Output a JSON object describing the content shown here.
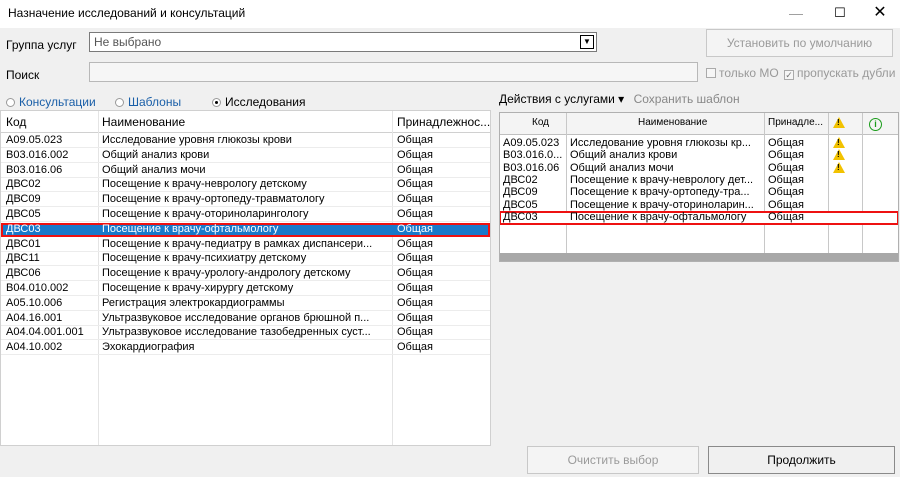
{
  "window": {
    "title": "Назначение исследований и консультаций",
    "minimize": "—",
    "maximize": "☐",
    "close": "✕"
  },
  "form": {
    "group_label": "Группа услуг",
    "group_value": "Не выбрано",
    "default_button": "Установить по умолчанию",
    "search_label": "Поиск",
    "search_value": "",
    "only_mo_label": "только МО",
    "only_mo_checked": false,
    "skip_dup_label": "пропускать дубли",
    "skip_dup_checked": true
  },
  "radios": {
    "consultations": "Консультации",
    "templates": "Шаблоны",
    "research": "Исследования",
    "selected": "research"
  },
  "left_table": {
    "headers": {
      "code": "Код",
      "name": "Наименование",
      "owner": "Принадлежнос..."
    },
    "rows": [
      {
        "code": "A09.05.023",
        "name": "Исследование уровня глюкозы крови",
        "owner": "Общая"
      },
      {
        "code": "B03.016.002",
        "name": "Общий анализ крови",
        "owner": "Общая"
      },
      {
        "code": "B03.016.06",
        "name": "Общий анализ мочи",
        "owner": "Общая"
      },
      {
        "code": "ДВС02",
        "name": "Посещение к врачу-неврологу детскому",
        "owner": "Общая"
      },
      {
        "code": "ДВС09",
        "name": "Посещение к врачу-ортопеду-травматологу",
        "owner": "Общая"
      },
      {
        "code": "ДВС05",
        "name": "Посещение к врачу-оториноларингологу",
        "owner": "Общая"
      },
      {
        "code": "ДВС03",
        "name": "Посещение к врачу-офтальмологу",
        "owner": "Общая",
        "selected": true
      },
      {
        "code": "ДВС01",
        "name": "Посещение к врачу-педиатру в рамках диспансери...",
        "owner": "Общая"
      },
      {
        "code": "ДВС11",
        "name": "Посещение к врачу-психиатру детскому",
        "owner": "Общая"
      },
      {
        "code": "ДВС06",
        "name": "Посещение к врачу-урологу-андрологу детскому",
        "owner": "Общая"
      },
      {
        "code": "B04.010.002",
        "name": "Посещение к врачу-хирургу детскому",
        "owner": "Общая"
      },
      {
        "code": "A05.10.006",
        "name": "Регистрация электрокардиограммы",
        "owner": "Общая"
      },
      {
        "code": "A04.16.001",
        "name": "Ультразвуковое исследование органов брюшной п...",
        "owner": "Общая"
      },
      {
        "code": "A04.04.001.001",
        "name": "Ультразвуковое исследование тазобедренных суст...",
        "owner": "Общая"
      },
      {
        "code": "A04.10.002",
        "name": "Эхокардиография",
        "owner": "Общая"
      }
    ]
  },
  "right_panel": {
    "actions_label": "Действия с услугами ▾",
    "save_template_label": "Сохранить шаблон",
    "headers": {
      "code": "Код",
      "name": "Наименование",
      "owner": "Принадле..."
    },
    "rows": [
      {
        "code": "A09.05.023",
        "name": "Исследование уровня глюкозы кр...",
        "owner": "Общая",
        "warning": true
      },
      {
        "code": "B03.016.0...",
        "name": "Общий анализ крови",
        "owner": "Общая",
        "warning": true
      },
      {
        "code": "B03.016.06",
        "name": "Общий анализ мочи",
        "owner": "Общая",
        "warning": true
      },
      {
        "code": "ДВС02",
        "name": "Посещение к врачу-неврологу дет...",
        "owner": "Общая",
        "warning": false
      },
      {
        "code": "ДВС09",
        "name": "Посещение к врачу-ортопеду-тра...",
        "owner": "Общая",
        "warning": false
      },
      {
        "code": "ДВС05",
        "name": "Посещение к врачу-оториноларин...",
        "owner": "Общая",
        "warning": false
      },
      {
        "code": "ДВС03",
        "name": "Посещение к врачу-офтальмологу",
        "owner": "Общая",
        "warning": false,
        "selected": true
      }
    ]
  },
  "buttons": {
    "clear": "Очистить выбор",
    "continue": "Продолжить"
  },
  "icons": {
    "warning": "warning-triangle-icon",
    "info": "info-circle-icon",
    "dropdown": "dropdown-arrow-icon",
    "info_glyph": "i",
    "dropdown_glyph": "▼",
    "check_glyph": "✓"
  },
  "colors": {
    "selection": "#1979ca",
    "highlight_border": "#ee1111",
    "warning": "#f2c200",
    "info": "#1a9c1a",
    "link": "#1a5fa8"
  }
}
